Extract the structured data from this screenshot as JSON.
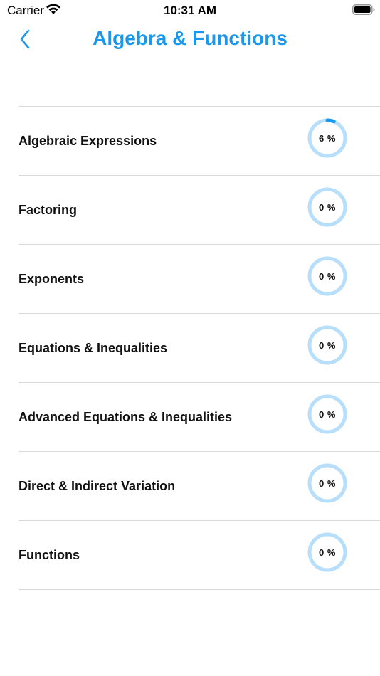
{
  "status_bar": {
    "carrier": "Carrier",
    "time": "10:31 AM"
  },
  "nav": {
    "title": "Algebra & Functions",
    "back_icon": "chevron-left-icon"
  },
  "colors": {
    "accent": "#1a98ee",
    "ring_track": "#b7defa",
    "ring_fill": "#1a98ee",
    "divider": "#d9d9d9"
  },
  "topics": [
    {
      "label": "Algebraic Expressions",
      "progress": 6,
      "progress_text": "6 %"
    },
    {
      "label": "Factoring",
      "progress": 0,
      "progress_text": "0 %"
    },
    {
      "label": "Exponents",
      "progress": 0,
      "progress_text": "0 %"
    },
    {
      "label": "Equations & Inequalities",
      "progress": 0,
      "progress_text": "0 %"
    },
    {
      "label": "Advanced Equations & Inequalities",
      "progress": 0,
      "progress_text": "0 %"
    },
    {
      "label": "Direct & Indirect Variation",
      "progress": 0,
      "progress_text": "0 %"
    },
    {
      "label": "Functions",
      "progress": 0,
      "progress_text": "0 %"
    }
  ]
}
